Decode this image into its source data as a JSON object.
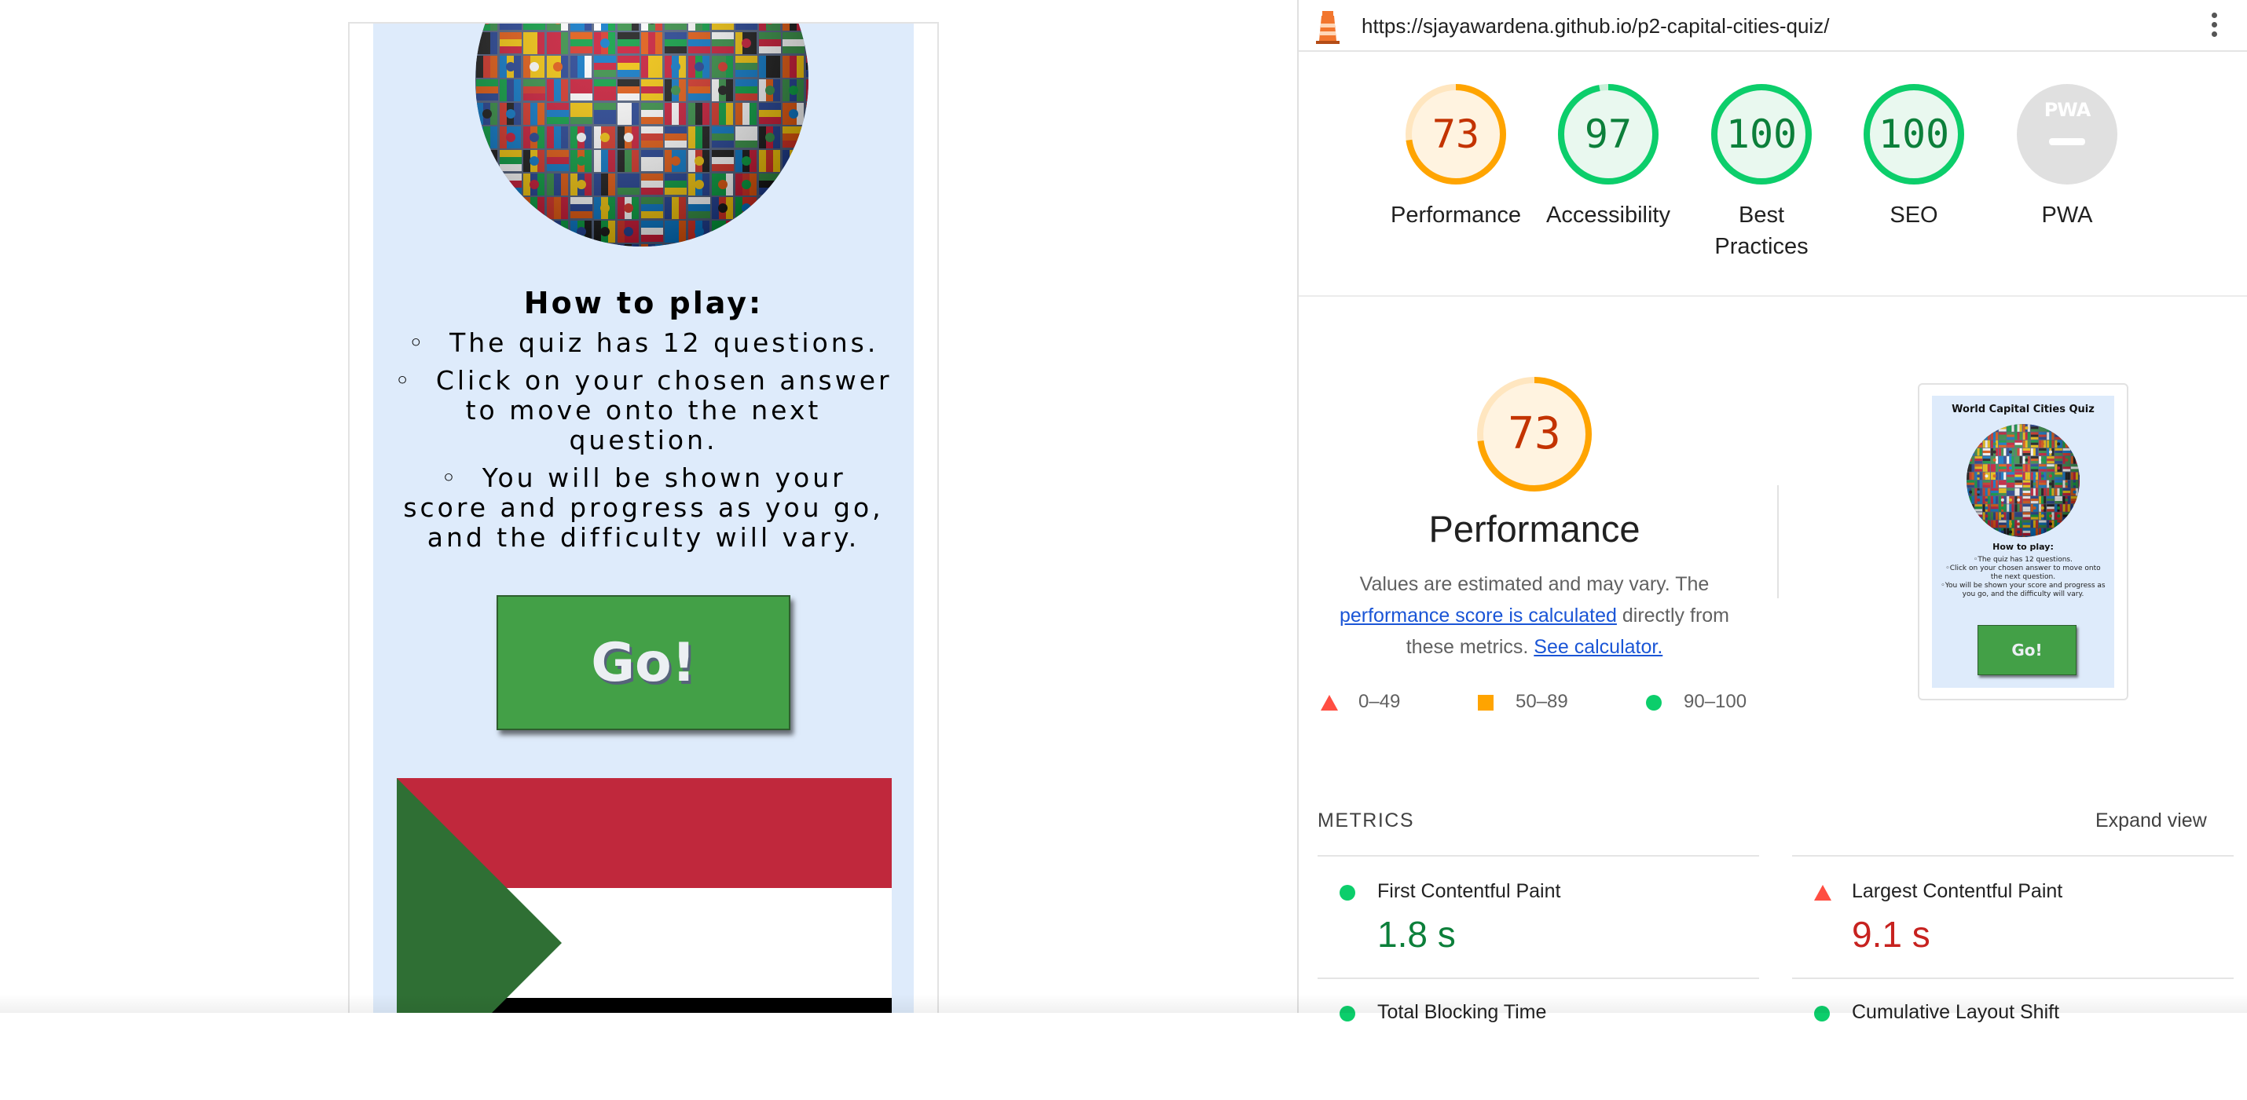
{
  "quiz": {
    "how_to_play_title": "How to play:",
    "instructions": [
      "The quiz has 12 questions.",
      "Click on your chosen answer to move onto the next question.",
      "You will be shown your score and progress as you go, and the difficulty will vary."
    ],
    "go_button_label": "Go!"
  },
  "lighthouse": {
    "url": "https://sjayawardena.github.io/p2-capital-cities-quiz/",
    "categories": [
      {
        "label": "Performance",
        "score": "73",
        "rating": "average"
      },
      {
        "label": "Accessibility",
        "score": "97",
        "rating": "pass"
      },
      {
        "label": "Best Practices",
        "score": "100",
        "rating": "pass"
      },
      {
        "label": "SEO",
        "score": "100",
        "rating": "pass"
      },
      {
        "label": "PWA",
        "score": "PWA",
        "rating": "na"
      }
    ],
    "performance": {
      "score": "73",
      "title": "Performance",
      "desc_part1": "Values are estimated and may vary. The",
      "desc_link1": "performance score is calculated",
      "desc_part2": "directly from these metrics.",
      "desc_link2": "See calculator."
    },
    "legend": [
      {
        "range": "0–49",
        "shape": "triangle-icon"
      },
      {
        "range": "50–89",
        "shape": "square-icon"
      },
      {
        "range": "90–100",
        "shape": "circle-icon"
      }
    ],
    "thumbnail": {
      "title": "World Capital Cities Quiz",
      "how_to_play": "How to play:",
      "instructions": [
        "The quiz has 12 questions.",
        "Click on your chosen answer to move onto the next question.",
        "You will be shown your score and progress as you go, and the difficulty will vary."
      ],
      "go": "Go!"
    },
    "metrics_header": "METRICS",
    "expand_view": "Expand view",
    "metrics": [
      {
        "name": "First Contentful Paint",
        "value": "1.8 s",
        "rating": "pass"
      },
      {
        "name": "Largest Contentful Paint",
        "value": "9.1 s",
        "rating": "fail"
      },
      {
        "name": "Total Blocking Time",
        "value": "",
        "rating": "pass"
      },
      {
        "name": "Cumulative Layout Shift",
        "value": "",
        "rating": "pass"
      }
    ],
    "colors": {
      "pass": "#0c7f3a",
      "pass_ring": "#0cce6b",
      "average": "#c33300",
      "average_ring": "#ffa400",
      "fail": "#c7221f",
      "fail_mark": "#ff4e42",
      "link": "#1a55d6"
    }
  }
}
